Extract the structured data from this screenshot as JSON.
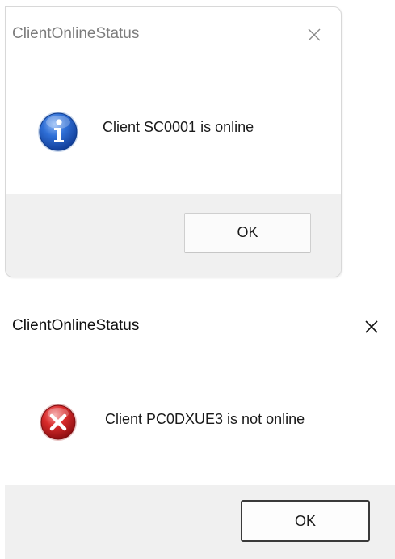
{
  "dialogs": [
    {
      "title": "ClientOnlineStatus",
      "icon": "info-icon",
      "message": "Client SC0001 is online",
      "ok_label": "OK",
      "focused": false
    },
    {
      "title": "ClientOnlineStatus",
      "icon": "error-icon",
      "message": "Client PC0DXUE3 is not online",
      "ok_label": "OK",
      "focused": true
    }
  ],
  "colors": {
    "info_blue": "#1f5fc8",
    "error_red": "#d2202a",
    "footer_bg": "#f0f0f0"
  }
}
